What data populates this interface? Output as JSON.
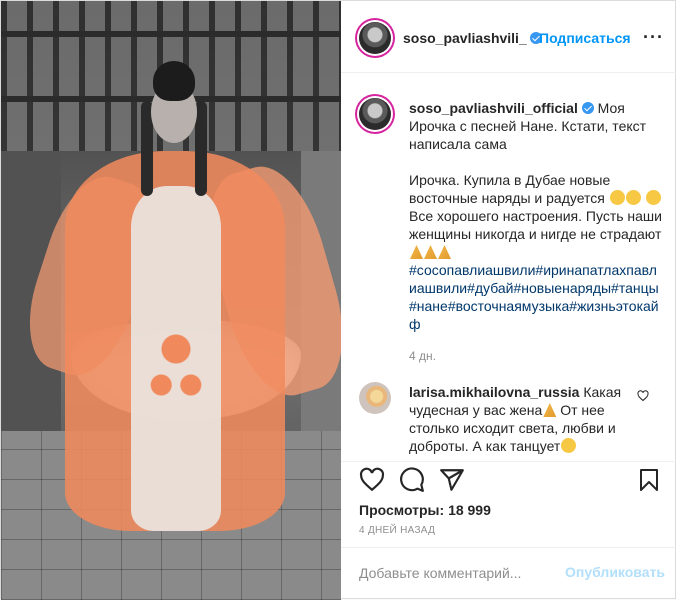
{
  "header": {
    "username": "soso_pavliashvili_of",
    "separator": "•",
    "follow_label": "Подписаться",
    "more_label": "···"
  },
  "caption": {
    "username": "soso_pavliashvili_official",
    "line1": "Моя Ирочка с песней Нане. Кстати, текст написала сама",
    "line2a": "Ирочка. Купила в Дубае новые восточные наряды и радуется",
    "line2b": "Все хорошего настроения. Пусть наши женщины никогда и нигде не страдают",
    "hashtags": "#сосопавлиашвили#иринапатлахпавлиашвили#дубай#новыенаряды#танцы#нане#восточнаямузыка#жизньэтокайф",
    "time": "4 дн."
  },
  "comment": {
    "username": "larisa.mikhailovna_russia",
    "text": "Какая чудесная у вас жена",
    "text2": "От нее столько исходит света, любви и доброты. А как танцует"
  },
  "actions": {
    "views_label": "Просмотры:",
    "views_count": "18 999",
    "date": "4 ДНЕЙ НАЗАД"
  },
  "add_comment": {
    "placeholder": "Добавьте комментарий...",
    "post_label": "Опубликовать"
  },
  "colors": {
    "accent": "#0095f6",
    "verified": "#3897f0",
    "disabled_post": "#b2dffc",
    "dress": "#f08a5d"
  },
  "icons": [
    "verified-badge-icon",
    "more-options-icon",
    "heart-icon",
    "comment-icon",
    "share-icon",
    "bookmark-icon",
    "like-comment-icon"
  ]
}
